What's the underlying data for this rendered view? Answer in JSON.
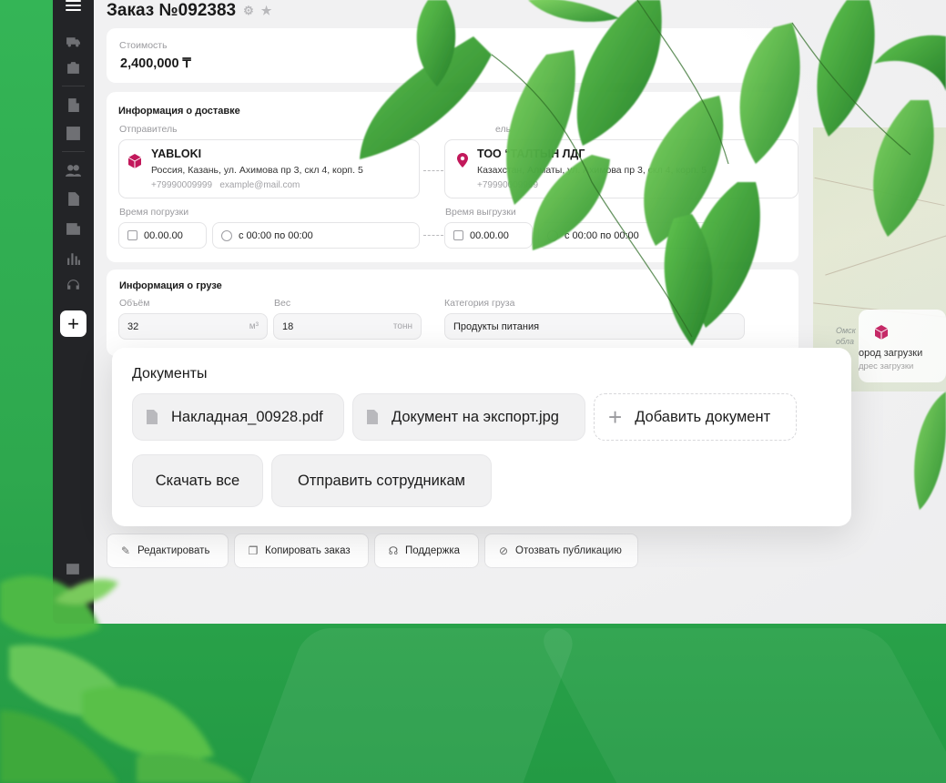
{
  "order": {
    "title": "Заказ №092383",
    "gear_icon": "gear-icon",
    "star_icon": "star-icon"
  },
  "cost": {
    "label": "Стоимость",
    "value": "2,400,000 ₸"
  },
  "delivery": {
    "heading": "Информация о доставке",
    "sender_label": "Отправитель",
    "receiver_label": "ель",
    "sender": {
      "name": "YABLOKI",
      "address": "Россия, Казань, ул. Ахимова пр 3, скл 4, корп. 5",
      "phone": "+79990009999",
      "email": "example@mail.com"
    },
    "receiver": {
      "name": "ТОО “ТАЛТЫН ЛДГ",
      "address": "Казахстан, Алматы, ул. Ахимова пр 3, скл 4, корп. 5",
      "phone": "+79990009999"
    },
    "load_time_label": "Время погрузки",
    "unload_time_label": "Время выгрузки",
    "load_date": "00.00.00",
    "load_range": "с 00:00 по 00:00",
    "unload_date": "00.00.00",
    "unload_range": "с 00:00 по 00:00"
  },
  "cargo": {
    "heading": "Информация о грузе",
    "volume_label": "Объём",
    "volume_value": "32",
    "volume_unit": "м³",
    "weight_label": "Вес",
    "weight_value": "18",
    "weight_unit": "тонн",
    "category_label": "Категория груза",
    "category_value": "Продукты питания"
  },
  "map": {
    "label_1": "Омск",
    "label_2": "обла",
    "pin_title": "ород загрузки",
    "pin_sub": "дрес загрузки"
  },
  "documents": {
    "heading": "Документы",
    "files": [
      "Накладная_00928.pdf",
      "Документ на экспорт.jpg"
    ],
    "add_label": "Добавить документ",
    "download_all": "Скачать все",
    "send_staff": "Отправить сотрудникам"
  },
  "actions": {
    "edit": "Редактировать",
    "copy": "Копировать заказ",
    "support": "Поддержка",
    "revoke": "Отозвать публикацию"
  },
  "colors": {
    "brand_green": "#2fae4e",
    "accent_magenta": "#c2185b",
    "sidebar": "#232427"
  }
}
